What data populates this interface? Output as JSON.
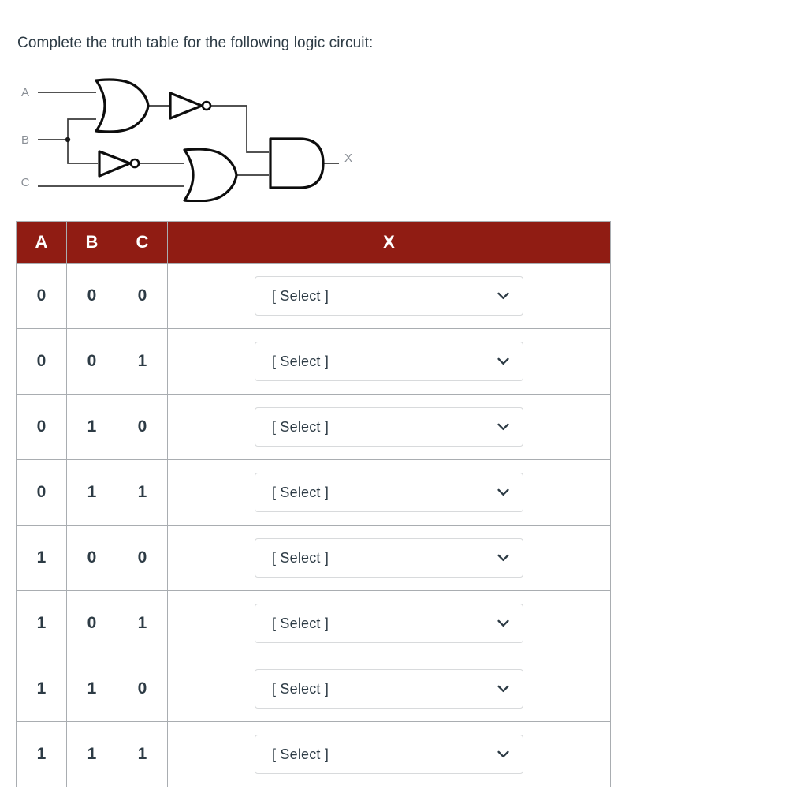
{
  "question": {
    "prompt": "Complete the truth table for the following logic circuit:"
  },
  "circuit": {
    "inputs": [
      {
        "label": "A"
      },
      {
        "label": "B"
      },
      {
        "label": "C"
      }
    ],
    "output": {
      "label": "X"
    },
    "gates": [
      {
        "id": "or1",
        "type": "OR",
        "inputs": [
          "A",
          "B"
        ]
      },
      {
        "id": "not1",
        "type": "NOT",
        "inputs": [
          "or1"
        ]
      },
      {
        "id": "not2",
        "type": "NOT",
        "inputs": [
          "B"
        ]
      },
      {
        "id": "or2",
        "type": "OR",
        "inputs": [
          "not2",
          "C"
        ]
      },
      {
        "id": "and1",
        "type": "AND",
        "inputs": [
          "not1",
          "or2"
        ]
      }
    ]
  },
  "table": {
    "headers": [
      "A",
      "B",
      "C",
      "X"
    ],
    "select_placeholder": "[ Select ]",
    "rows": [
      {
        "a": "0",
        "b": "0",
        "c": "0",
        "x": "[ Select ]"
      },
      {
        "a": "0",
        "b": "0",
        "c": "1",
        "x": "[ Select ]"
      },
      {
        "a": "0",
        "b": "1",
        "c": "0",
        "x": "[ Select ]"
      },
      {
        "a": "0",
        "b": "1",
        "c": "1",
        "x": "[ Select ]"
      },
      {
        "a": "1",
        "b": "0",
        "c": "0",
        "x": "[ Select ]"
      },
      {
        "a": "1",
        "b": "0",
        "c": "1",
        "x": "[ Select ]"
      },
      {
        "a": "1",
        "b": "1",
        "c": "0",
        "x": "[ Select ]"
      },
      {
        "a": "1",
        "b": "1",
        "c": "1",
        "x": "[ Select ]"
      }
    ]
  },
  "colors": {
    "header_background": "#901c13",
    "header_text": "#ffffff",
    "body_text": "#2d3b45",
    "select_border": "#d8dadc",
    "wire": "#3a3a3a",
    "io_label": "#8a8f96"
  }
}
